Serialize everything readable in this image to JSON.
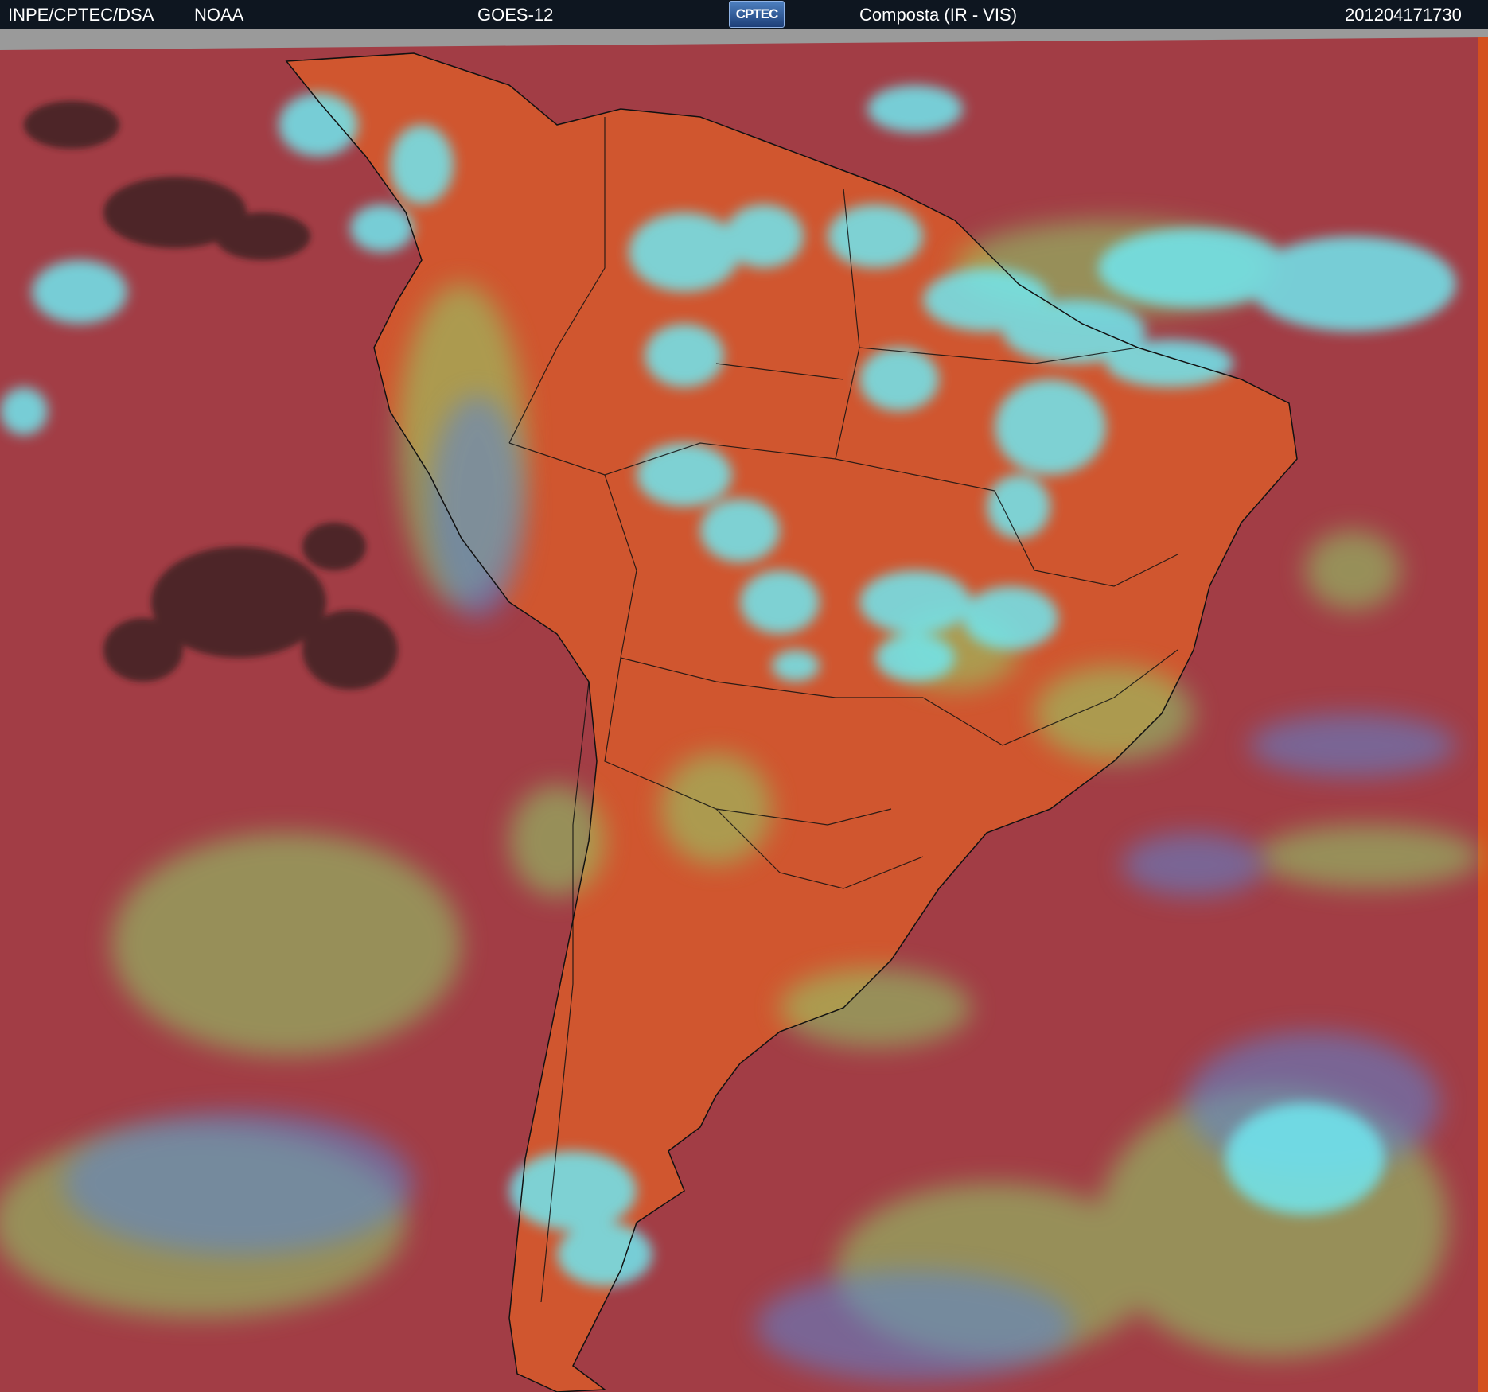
{
  "header": {
    "agency": "INPE/CPTEC/DSA",
    "provider": "NOAA",
    "satellite": "GOES-12",
    "logo_text": "CPTEC",
    "product": "Composta (IR - VIS)",
    "timestamp": "201204171730"
  },
  "image": {
    "type": "satellite-composite",
    "region": "South America",
    "colors": {
      "ocean_clear": "#a23d45",
      "land_warm": "#d85a2c",
      "low_cloud": "#8fd36a",
      "high_cloud": "#6fe7f0",
      "mid_cloud": "#5a86d6",
      "cold_deep_cloud": "#2a1a1a",
      "border_lines": "#111111",
      "no_data_strip": "#9a9a9a"
    }
  }
}
